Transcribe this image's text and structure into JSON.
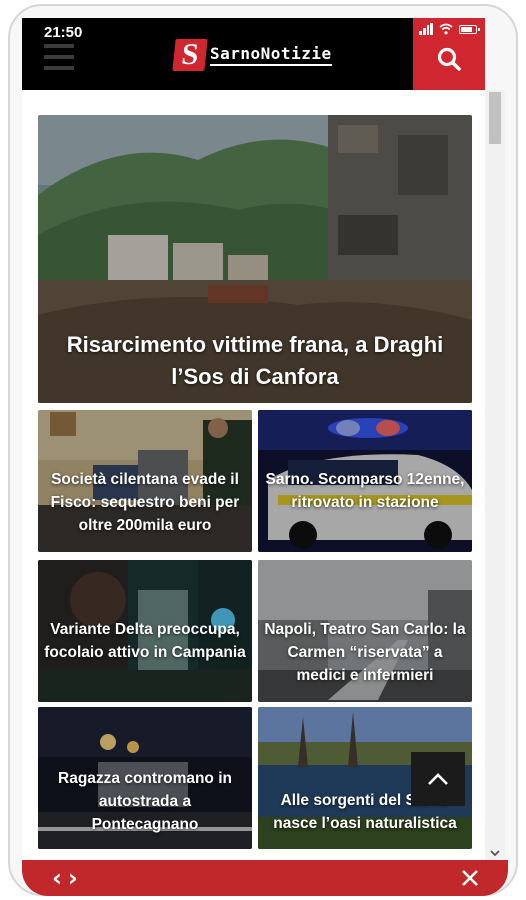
{
  "status": {
    "time": "21:50"
  },
  "header": {
    "logo_text": "SarnoNotizie",
    "logo_mark": "S"
  },
  "icons": {
    "menu": "menu-icon",
    "search": "search-icon",
    "back_to_top": "chevron-up-icon",
    "prev": "chevron-left-icon",
    "next": "chevron-right-icon",
    "close": "close-icon"
  },
  "colors": {
    "brand_red": "#d0262f",
    "header_bg": "#000000",
    "footer_bg": "#c0282c"
  },
  "hero": {
    "title": "Risarcimento vittime frana, a Draghi l’Sos di Canfora"
  },
  "articles": [
    {
      "title": "Società cilentana evade il Fisco: sequestro beni per oltre 200mila euro"
    },
    {
      "title": "Sarno. Scomparso 12enne, ritrovato in stazione"
    },
    {
      "title": "Variante Delta preoccupa, focolaio attivo in Campania"
    },
    {
      "title": "Napoli, Teatro San Carlo: la Carmen “riservata” a medici e infermieri"
    },
    {
      "title": "Ragazza contromano in autostrada a Pontecagnano"
    },
    {
      "title": "Alle sorgenti del Sarno nasce l’oasi naturalistica"
    }
  ],
  "footer": {
    "prev_label": "‹",
    "next_label": "›"
  }
}
